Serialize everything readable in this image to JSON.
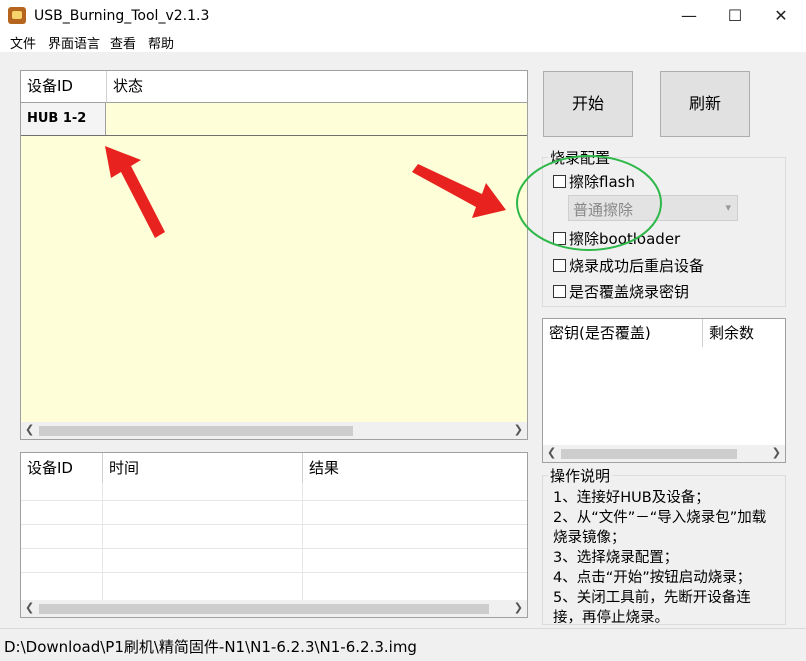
{
  "window": {
    "title": "USB_Burning_Tool_v2.1.3",
    "minimize": "—",
    "maximize": "☐",
    "close": "✕"
  },
  "menu": [
    "文件",
    "界面语言",
    "查看",
    "帮助"
  ],
  "device_grid": {
    "headers": [
      "设备ID",
      "状态"
    ],
    "rows": [
      {
        "id": "HUB 1-2",
        "status": ""
      }
    ]
  },
  "buttons": {
    "start": "开始",
    "refresh": "刷新"
  },
  "burn_config": {
    "title": "烧录配置",
    "erase_flash": "擦除flash",
    "erase_mode": "普通擦除",
    "erase_bootloader": "擦除bootloader",
    "reboot_after_success": "烧录成功后重启设备",
    "overwrite_key": "是否覆盖烧录密钥"
  },
  "key_grid": {
    "headers": [
      "密钥(是否覆盖)",
      "剩余数"
    ]
  },
  "log_grid": {
    "headers": [
      "设备ID",
      "时间",
      "结果"
    ]
  },
  "instructions": {
    "title": "操作说明",
    "lines": [
      "1、连接好HUB及设备；",
      "2、从“文件”－“导入烧录包”加载",
      "烧录镜像；",
      "3、选择烧录配置；",
      "4、点击“开始”按钮启动烧录；",
      "5、关闭工具前，先断开设备连",
      "接，再停止烧录。"
    ]
  },
  "status_bar": {
    "path": "D:\\Download\\P1刷机\\精简固件-N1\\N1-6.2.3\\N1-6.2.3.img"
  },
  "colors": {
    "grid_bg": "#fefed8",
    "annotation_arrow": "#e8231f",
    "annotation_circle": "#2fb84a"
  }
}
